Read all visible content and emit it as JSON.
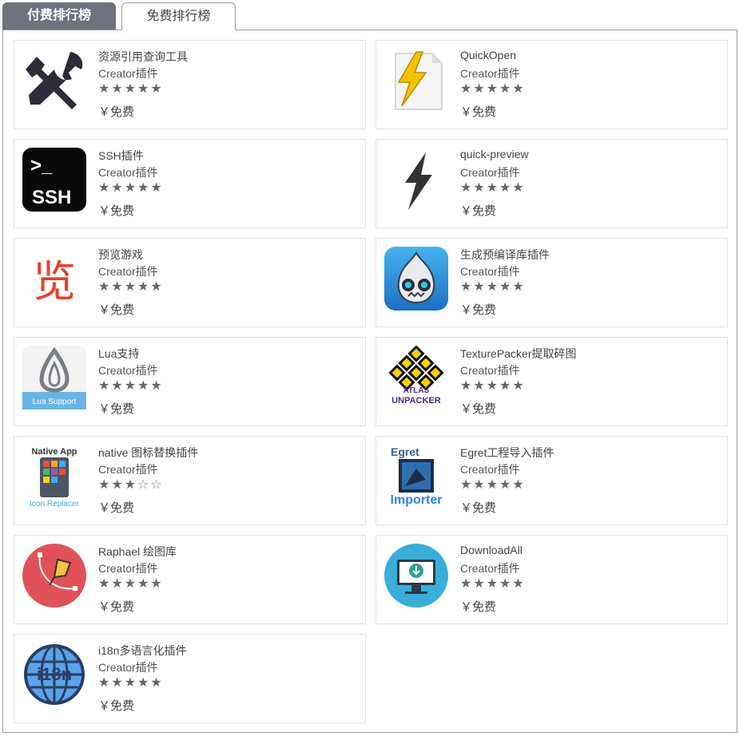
{
  "tabs": {
    "paid": "付费排行榜",
    "free": "免费排行榜"
  },
  "items": [
    {
      "title": "资源引用查询工具",
      "type": "Creator插件",
      "rating": 5,
      "price": "￥免费",
      "icon": "tools-icon"
    },
    {
      "title": "QuickOpen",
      "type": "Creator插件",
      "rating": 5,
      "price": "￥免费",
      "icon": "lightning-document-icon"
    },
    {
      "title": "SSH插件",
      "type": "Creator插件",
      "rating": 5,
      "price": "￥免费",
      "icon": "ssh-terminal-icon",
      "icon_text": ">_",
      "icon_text2": "SSH"
    },
    {
      "title": "quick-preview",
      "type": "Creator插件",
      "rating": 5,
      "price": "￥免费",
      "icon": "lightning-bolt-icon"
    },
    {
      "title": "预览游戏",
      "type": "Creator插件",
      "rating": 5,
      "price": "￥免费",
      "icon": "preview-glyph-icon",
      "icon_text": "览"
    },
    {
      "title": "生成预编译库插件",
      "type": "Creator插件",
      "rating": 5,
      "price": "￥免费",
      "icon": "cocos-mascot-icon"
    },
    {
      "title": "Lua支持",
      "type": "Creator插件",
      "rating": 5,
      "price": "￥免费",
      "icon": "lua-support-icon",
      "icon_text": "Lua Support"
    },
    {
      "title": "TexturePacker提取碎图",
      "type": "Creator插件",
      "rating": 5,
      "price": "￥免费",
      "icon": "atlas-unpacker-icon",
      "icon_text": "ATLAS",
      "icon_text2": "UNPACKER"
    },
    {
      "title": "native 图标替换插件",
      "type": "Creator插件",
      "rating": 3,
      "price": "￥免费",
      "icon": "native-app-icon-replacer-icon",
      "icon_text": "Native App",
      "icon_text2": "Icon Replacer"
    },
    {
      "title": "Egret工程导入插件",
      "type": "Creator插件",
      "rating": 5,
      "price": "￥免费",
      "icon": "egret-importer-icon",
      "icon_text": "Egret",
      "icon_text2": "Importer"
    },
    {
      "title": "Raphael 绘图库",
      "type": "Creator插件",
      "rating": 5,
      "price": "￥免费",
      "icon": "pen-bezier-icon"
    },
    {
      "title": "DownloadAll",
      "type": "Creator插件",
      "rating": 5,
      "price": "￥免费",
      "icon": "monitor-download-icon"
    },
    {
      "title": "i18n多语言化插件",
      "type": "Creator插件",
      "rating": 5,
      "price": "￥免费",
      "icon": "globe-i18n-icon",
      "icon_text": "i18n"
    }
  ]
}
